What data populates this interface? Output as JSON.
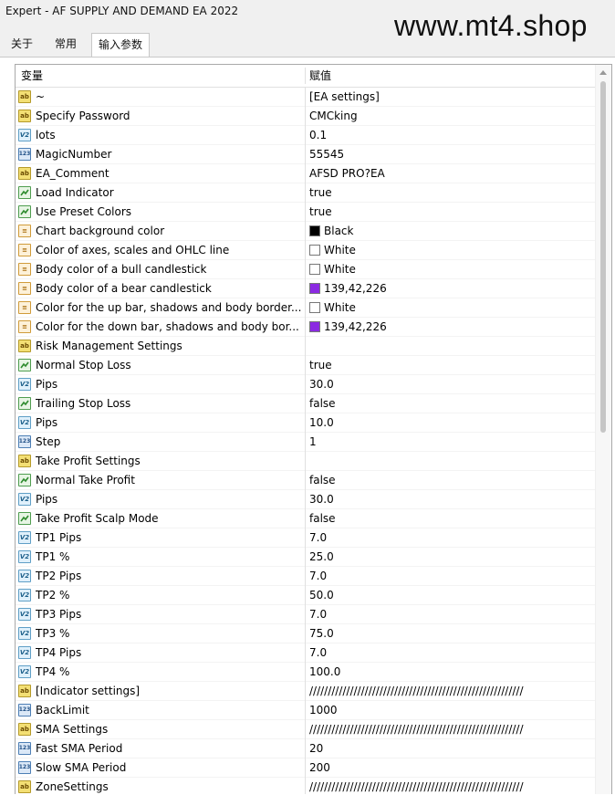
{
  "window": {
    "title": "Expert - AF SUPPLY AND DEMAND EA 2022"
  },
  "watermark": "www.mt4.shop",
  "tabs": [
    {
      "label": "关于",
      "active": false
    },
    {
      "label": "常用",
      "active": false
    },
    {
      "label": "输入参数",
      "active": true
    }
  ],
  "grid": {
    "headers": {
      "variable": "变量",
      "value": "赋值"
    },
    "rows": [
      {
        "type": "ab",
        "icon": "string-icon",
        "name": "~",
        "value": "[EA settings]"
      },
      {
        "type": "ab",
        "icon": "string-icon",
        "name": "Specify Password",
        "value": "CMCking"
      },
      {
        "type": "dbl",
        "icon": "double-icon",
        "name": "lots",
        "value": "0.1"
      },
      {
        "type": "int",
        "icon": "integer-icon",
        "name": "MagicNumber",
        "value": "55545"
      },
      {
        "type": "ab",
        "icon": "string-icon",
        "name": "EA_Comment",
        "value": "AFSD PRO?EA"
      },
      {
        "type": "bool",
        "icon": "bool-icon",
        "name": "Load Indicator",
        "value": "true"
      },
      {
        "type": "bool",
        "icon": "bool-icon",
        "name": "Use Preset Colors",
        "value": "true"
      },
      {
        "type": "col",
        "icon": "color-icon",
        "name": "Chart background color",
        "value": "Black",
        "swatch": "#000000"
      },
      {
        "type": "col",
        "icon": "color-icon",
        "name": "Color of axes, scales and OHLC line",
        "value": "White",
        "swatch": "#ffffff"
      },
      {
        "type": "col",
        "icon": "color-icon",
        "name": "Body color of a bull candlestick",
        "value": "White",
        "swatch": "#ffffff"
      },
      {
        "type": "col",
        "icon": "color-icon",
        "name": "Body color of a bear candlestick",
        "value": "139,42,226",
        "swatch": "#8b2ae2"
      },
      {
        "type": "col",
        "icon": "color-icon",
        "name": "Color for the up bar, shadows and body border...",
        "value": "White",
        "swatch": "#ffffff"
      },
      {
        "type": "col",
        "icon": "color-icon",
        "name": "Color for the down bar, shadows and body bor...",
        "value": "139,42,226",
        "swatch": "#8b2ae2"
      },
      {
        "type": "ab",
        "icon": "string-icon",
        "name": "Risk Management Settings",
        "value": ""
      },
      {
        "type": "bool",
        "icon": "bool-icon",
        "name": "Normal Stop Loss",
        "value": "true"
      },
      {
        "type": "dbl",
        "icon": "double-icon",
        "name": "Pips",
        "value": "30.0"
      },
      {
        "type": "bool",
        "icon": "bool-icon",
        "name": "Trailing Stop Loss",
        "value": "false"
      },
      {
        "type": "dbl",
        "icon": "double-icon",
        "name": "Pips",
        "value": "10.0"
      },
      {
        "type": "int",
        "icon": "integer-icon",
        "name": "Step",
        "value": "1"
      },
      {
        "type": "ab",
        "icon": "string-icon",
        "name": "Take Profit Settings",
        "value": ""
      },
      {
        "type": "bool",
        "icon": "bool-icon",
        "name": "Normal Take Profit",
        "value": "false"
      },
      {
        "type": "dbl",
        "icon": "double-icon",
        "name": "Pips",
        "value": "30.0"
      },
      {
        "type": "bool",
        "icon": "bool-icon",
        "name": "Take Profit Scalp Mode",
        "value": "false"
      },
      {
        "type": "dbl",
        "icon": "double-icon",
        "name": "TP1 Pips",
        "value": "7.0"
      },
      {
        "type": "dbl",
        "icon": "double-icon",
        "name": "TP1 %",
        "value": "25.0"
      },
      {
        "type": "dbl",
        "icon": "double-icon",
        "name": "TP2 Pips",
        "value": "7.0"
      },
      {
        "type": "dbl",
        "icon": "double-icon",
        "name": "TP2 %",
        "value": "50.0"
      },
      {
        "type": "dbl",
        "icon": "double-icon",
        "name": "TP3 Pips",
        "value": "7.0"
      },
      {
        "type": "dbl",
        "icon": "double-icon",
        "name": "TP3 %",
        "value": "75.0"
      },
      {
        "type": "dbl",
        "icon": "double-icon",
        "name": "TP4 Pips",
        "value": "7.0"
      },
      {
        "type": "dbl",
        "icon": "double-icon",
        "name": "TP4 %",
        "value": "100.0"
      },
      {
        "type": "ab",
        "icon": "string-icon",
        "name": "[Indicator settings]",
        "value": "//////////////////////////////////////////////////////////"
      },
      {
        "type": "int",
        "icon": "integer-icon",
        "name": "BackLimit",
        "value": "1000"
      },
      {
        "type": "ab",
        "icon": "string-icon",
        "name": "SMA Settings",
        "value": "//////////////////////////////////////////////////////////"
      },
      {
        "type": "int",
        "icon": "integer-icon",
        "name": "Fast SMA Period",
        "value": "20"
      },
      {
        "type": "int",
        "icon": "integer-icon",
        "name": "Slow SMA Period",
        "value": "200"
      },
      {
        "type": "ab",
        "icon": "string-icon",
        "name": "ZoneSettings",
        "value": "//////////////////////////////////////////////////////////"
      }
    ]
  },
  "icon_glyphs": {
    "ab": "ab",
    "dbl": "V2",
    "int": "123",
    "col": "≡"
  },
  "colors": {
    "tab_active_bg": "#ffffff",
    "grid_border": "#a9a9a9",
    "scroll_thumb": "#c6c6c6"
  }
}
